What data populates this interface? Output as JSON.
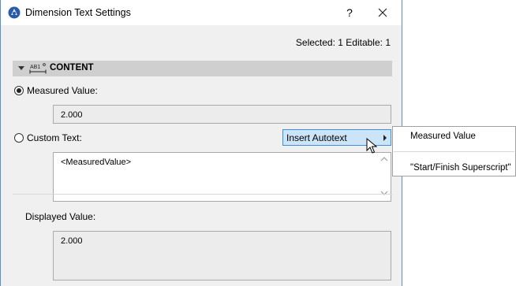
{
  "window": {
    "title": "Dimension Text Settings",
    "help_label": "?"
  },
  "selection_info": "Selected: 1 Editable: 1",
  "section": {
    "title": "CONTENT",
    "icon_text": "AB1"
  },
  "measured_value": {
    "label": "Measured Value:",
    "value": "2.000",
    "selected": true
  },
  "custom_text": {
    "label": "Custom Text:",
    "value": "<MeasuredValue>",
    "selected": false
  },
  "insert_autotext": {
    "label": "Insert Autotext"
  },
  "autotext_menu": {
    "items": [
      "Measured Value",
      "\"Start/Finish Superscript\""
    ]
  },
  "displayed_value": {
    "label": "Displayed Value:",
    "value": "2.000"
  },
  "colors": {
    "accent": "#3d8ee0",
    "hover_fill": "#cce4f7",
    "section_bg": "#cfcfcf"
  }
}
